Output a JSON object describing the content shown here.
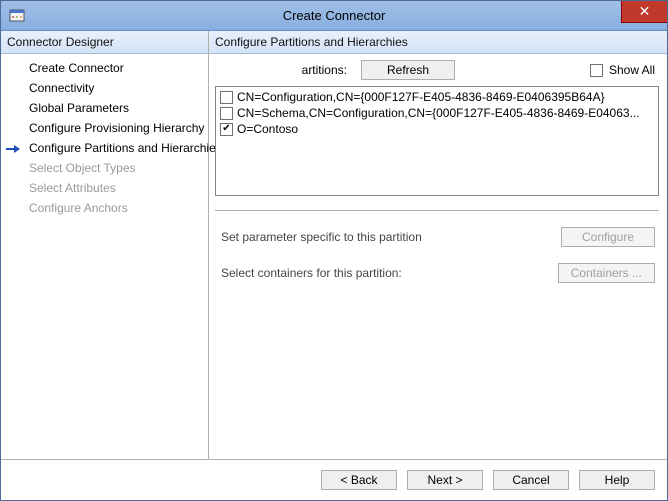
{
  "window": {
    "title": "Create Connector",
    "close_glyph": "✕"
  },
  "sidebar": {
    "header": "Connector Designer",
    "items": [
      {
        "label": "Create Connector",
        "state": "enabled"
      },
      {
        "label": "Connectivity",
        "state": "enabled"
      },
      {
        "label": "Global Parameters",
        "state": "enabled"
      },
      {
        "label": "Configure Provisioning Hierarchy",
        "state": "enabled"
      },
      {
        "label": "Configure Partitions and Hierarchies",
        "state": "current"
      },
      {
        "label": "Select Object Types",
        "state": "disabled"
      },
      {
        "label": "Select Attributes",
        "state": "disabled"
      },
      {
        "label": "Configure Anchors",
        "state": "disabled"
      }
    ]
  },
  "main": {
    "header": "Configure Partitions and Hierarchies",
    "partitions_label": "artitions:",
    "refresh_label": "Refresh",
    "show_all_label": "Show All",
    "show_all_checked": false,
    "list": [
      {
        "checked": false,
        "text": "CN=Configuration,CN={000F127F-E405-4836-8469-E0406395B64A}"
      },
      {
        "checked": false,
        "text": "CN=Schema,CN=Configuration,CN={000F127F-E405-4836-8469-E04063..."
      },
      {
        "checked": true,
        "text": "O=Contoso"
      }
    ],
    "param_label": "Set parameter specific to this partition",
    "configure_label": "Configure",
    "containers_prompt": "Select containers for this partition:",
    "containers_label": "Containers ..."
  },
  "footer": {
    "back": "<  Back",
    "next": "Next  >",
    "cancel": "Cancel",
    "help": "Help"
  }
}
